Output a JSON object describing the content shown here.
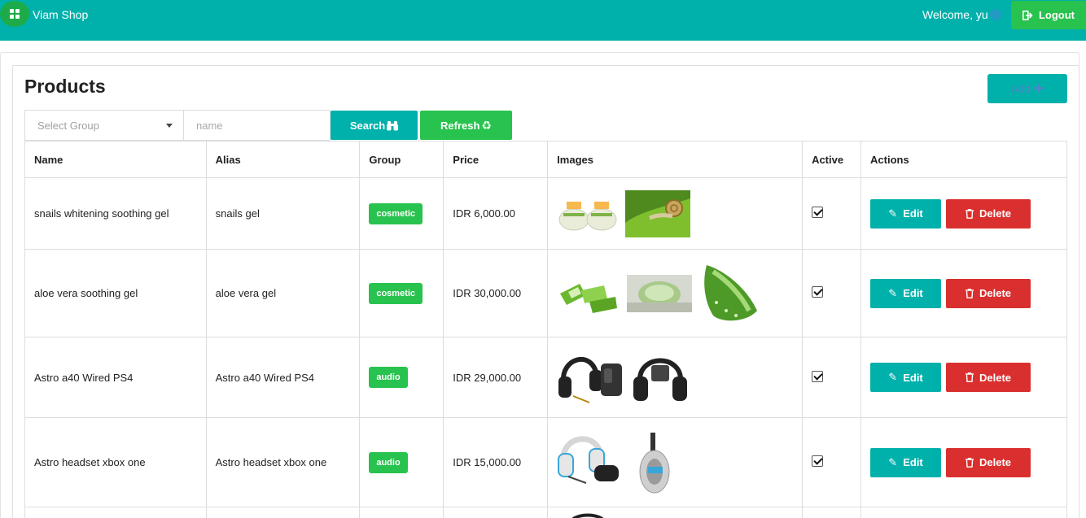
{
  "app": {
    "brand": "Viam Shop",
    "welcome": "Welcome, yu",
    "user_suffix": "0",
    "logout_label": "Logout"
  },
  "page": {
    "title": "Products",
    "add_label": "Add"
  },
  "filters": {
    "group_placeholder": "Select Group",
    "name_placeholder": "name",
    "search_label": "Search",
    "refresh_label": "Refresh"
  },
  "table": {
    "columns": [
      "Name",
      "Alias",
      "Group",
      "Price",
      "Images",
      "Active",
      "Actions"
    ],
    "rows": [
      {
        "name": "snails whitening soothing gel",
        "alias": "snails gel",
        "group": "cosmetic",
        "price": "IDR 6,000.00",
        "active": true,
        "images": [
          "gel jars",
          "snail on leaf"
        ]
      },
      {
        "name": "aloe vera soothing gel",
        "alias": "aloe vera gel",
        "group": "cosmetic",
        "price": "IDR 30,000.00",
        "active": true,
        "images": [
          "aloe slices",
          "aloe gel",
          "aloe leaf"
        ]
      },
      {
        "name": "Astro a40 Wired PS4",
        "alias": "Astro a40 Wired PS4",
        "group": "audio",
        "price": "IDR 29,000.00",
        "active": true,
        "images": [
          "black headset with mixamp",
          "black headset"
        ]
      },
      {
        "name": "Astro headset xbox one",
        "alias": "Astro headset xbox one",
        "group": "audio",
        "price": "IDR 15,000.00",
        "active": true,
        "images": [
          "white headset with controller",
          "white headset side"
        ]
      }
    ],
    "edit_label": "Edit",
    "delete_label": "Delete"
  },
  "colors": {
    "topbar": "#00b1ab",
    "success": "#28c24e",
    "primary": "#00b1ab",
    "danger": "#d9302f"
  },
  "icons": {
    "menu": "grid-icon",
    "logout": "sign-out-icon",
    "add": "plus-icon",
    "search": "binoculars-icon",
    "refresh": "recycle-icon",
    "edit": "pencil-icon",
    "delete": "trash-icon"
  }
}
